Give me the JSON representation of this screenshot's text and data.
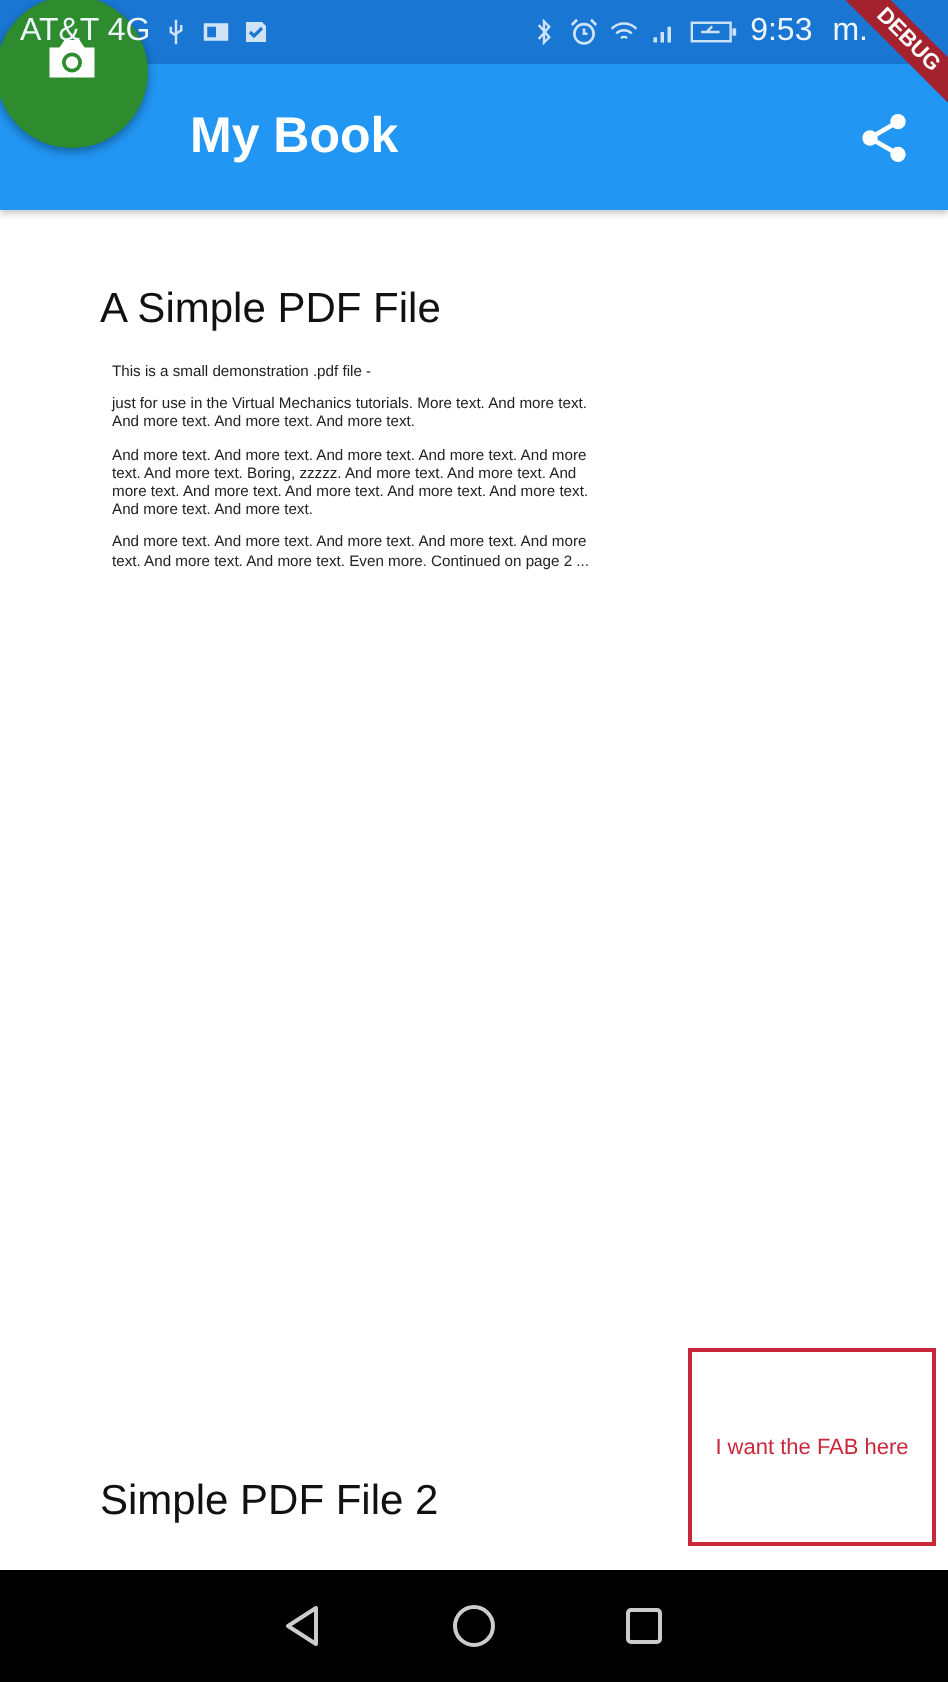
{
  "status_bar": {
    "carrier": "AT&T 4G",
    "time": "9:53",
    "time_suffix": "m."
  },
  "app_bar": {
    "title": "My Book"
  },
  "debug_banner": "DEBUG",
  "pages": [
    {
      "heading": "A Simple PDF File",
      "paragraphs": [
        "This is a small demonstration .pdf file -",
        "just for use in the Virtual Mechanics tutorials. More text. And more text. And more text. And more text. And more text.",
        "And more text. And more text. And more text. And more text. And more text. And more text. Boring, zzzzz. And more text. And more text. And more text. And more text. And more text. And more text. And more text. And more text. And more text.",
        "And more text. And more text. And more text. And more text. And more text. And more text. And more text. Even more. Continued on page 2 ..."
      ]
    },
    {
      "heading": "Simple PDF File 2"
    }
  ],
  "annotation": "I want the FAB here"
}
